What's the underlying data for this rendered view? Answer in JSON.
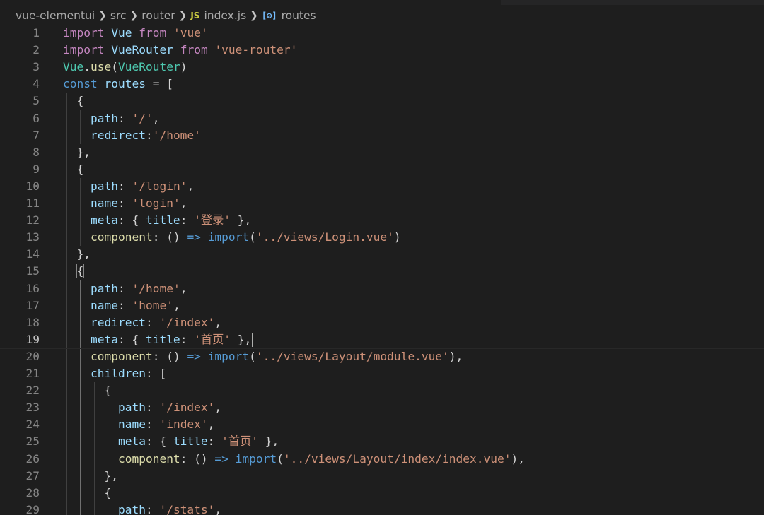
{
  "breadcrumb": {
    "items": [
      "vue-elementui",
      "src",
      "router",
      "index.js",
      "routes"
    ],
    "file_icon": "JS",
    "symbol_icon": "[⊘]"
  },
  "editor": {
    "current_line": 19,
    "lines": [
      {
        "n": "1",
        "t": [
          [
            "kw",
            "import"
          ],
          [
            "pun",
            " "
          ],
          [
            "id",
            "Vue"
          ],
          [
            "pun",
            " "
          ],
          [
            "kw",
            "from"
          ],
          [
            "pun",
            " "
          ],
          [
            "str",
            "'vue'"
          ]
        ]
      },
      {
        "n": "2",
        "t": [
          [
            "kw",
            "import"
          ],
          [
            "pun",
            " "
          ],
          [
            "id",
            "VueRouter"
          ],
          [
            "pun",
            " "
          ],
          [
            "kw",
            "from"
          ],
          [
            "pun",
            " "
          ],
          [
            "str",
            "'vue-router'"
          ]
        ]
      },
      {
        "n": "3",
        "t": [
          [
            "ty",
            "Vue"
          ],
          [
            "pun",
            "."
          ],
          [
            "fn",
            "use"
          ],
          [
            "pun",
            "("
          ],
          [
            "ty",
            "VueRouter"
          ],
          [
            "pun",
            ")"
          ]
        ]
      },
      {
        "n": "4",
        "t": [
          [
            "st",
            "const"
          ],
          [
            "pun",
            " "
          ],
          [
            "id",
            "routes"
          ],
          [
            "pun",
            " = ["
          ]
        ]
      },
      {
        "n": "5",
        "t": [
          [
            "pun",
            "  {"
          ]
        ]
      },
      {
        "n": "6",
        "t": [
          [
            "pun",
            "    "
          ],
          [
            "id",
            "path"
          ],
          [
            "pun",
            ": "
          ],
          [
            "str",
            "'/'"
          ],
          [
            "pun",
            ","
          ]
        ]
      },
      {
        "n": "7",
        "t": [
          [
            "pun",
            "    "
          ],
          [
            "id",
            "redirect"
          ],
          [
            "pun",
            ":"
          ],
          [
            "str",
            "'/home'"
          ]
        ]
      },
      {
        "n": "8",
        "t": [
          [
            "pun",
            "  },"
          ]
        ]
      },
      {
        "n": "9",
        "t": [
          [
            "pun",
            "  {"
          ]
        ]
      },
      {
        "n": "10",
        "t": [
          [
            "pun",
            "    "
          ],
          [
            "id",
            "path"
          ],
          [
            "pun",
            ": "
          ],
          [
            "str",
            "'/login'"
          ],
          [
            "pun",
            ","
          ]
        ]
      },
      {
        "n": "11",
        "t": [
          [
            "pun",
            "    "
          ],
          [
            "id",
            "name"
          ],
          [
            "pun",
            ": "
          ],
          [
            "str",
            "'login'"
          ],
          [
            "pun",
            ","
          ]
        ]
      },
      {
        "n": "12",
        "t": [
          [
            "pun",
            "    "
          ],
          [
            "id",
            "meta"
          ],
          [
            "pun",
            ": { "
          ],
          [
            "id",
            "title"
          ],
          [
            "pun",
            ": "
          ],
          [
            "str",
            "'登录'"
          ],
          [
            "pun",
            " },"
          ]
        ]
      },
      {
        "n": "13",
        "t": [
          [
            "pun",
            "    "
          ],
          [
            "fn",
            "component"
          ],
          [
            "pun",
            ": () "
          ],
          [
            "st",
            "=>"
          ],
          [
            "pun",
            " "
          ],
          [
            "st",
            "import"
          ],
          [
            "pun",
            "("
          ],
          [
            "str",
            "'../views/Login.vue'"
          ],
          [
            "pun",
            ")"
          ]
        ]
      },
      {
        "n": "14",
        "t": [
          [
            "pun",
            "  },"
          ]
        ]
      },
      {
        "n": "15",
        "t": [
          [
            "pun",
            "  "
          ],
          [
            "match",
            "{"
          ]
        ]
      },
      {
        "n": "16",
        "t": [
          [
            "pun",
            "    "
          ],
          [
            "id",
            "path"
          ],
          [
            "pun",
            ": "
          ],
          [
            "str",
            "'/home'"
          ],
          [
            "pun",
            ","
          ]
        ]
      },
      {
        "n": "17",
        "t": [
          [
            "pun",
            "    "
          ],
          [
            "id",
            "name"
          ],
          [
            "pun",
            ": "
          ],
          [
            "str",
            "'home'"
          ],
          [
            "pun",
            ","
          ]
        ]
      },
      {
        "n": "18",
        "t": [
          [
            "pun",
            "    "
          ],
          [
            "id",
            "redirect"
          ],
          [
            "pun",
            ": "
          ],
          [
            "str",
            "'/index'"
          ],
          [
            "pun",
            ","
          ]
        ]
      },
      {
        "n": "19",
        "t": [
          [
            "pun",
            "    "
          ],
          [
            "id",
            "meta"
          ],
          [
            "pun",
            ": { "
          ],
          [
            "id",
            "title"
          ],
          [
            "pun",
            ": "
          ],
          [
            "str",
            "'首页'"
          ],
          [
            "pun",
            " },"
          ],
          [
            "cursor",
            ""
          ]
        ]
      },
      {
        "n": "20",
        "t": [
          [
            "pun",
            "    "
          ],
          [
            "fn",
            "component"
          ],
          [
            "pun",
            ": () "
          ],
          [
            "st",
            "=>"
          ],
          [
            "pun",
            " "
          ],
          [
            "st",
            "import"
          ],
          [
            "pun",
            "("
          ],
          [
            "str",
            "'../views/Layout/module.vue'"
          ],
          [
            "pun",
            "),"
          ]
        ]
      },
      {
        "n": "21",
        "t": [
          [
            "pun",
            "    "
          ],
          [
            "id",
            "children"
          ],
          [
            "pun",
            ": ["
          ]
        ]
      },
      {
        "n": "22",
        "t": [
          [
            "pun",
            "      {"
          ]
        ]
      },
      {
        "n": "23",
        "t": [
          [
            "pun",
            "        "
          ],
          [
            "id",
            "path"
          ],
          [
            "pun",
            ": "
          ],
          [
            "str",
            "'/index'"
          ],
          [
            "pun",
            ","
          ]
        ]
      },
      {
        "n": "24",
        "t": [
          [
            "pun",
            "        "
          ],
          [
            "id",
            "name"
          ],
          [
            "pun",
            ": "
          ],
          [
            "str",
            "'index'"
          ],
          [
            "pun",
            ","
          ]
        ]
      },
      {
        "n": "25",
        "t": [
          [
            "pun",
            "        "
          ],
          [
            "id",
            "meta"
          ],
          [
            "pun",
            ": { "
          ],
          [
            "id",
            "title"
          ],
          [
            "pun",
            ": "
          ],
          [
            "str",
            "'首页'"
          ],
          [
            "pun",
            " },"
          ]
        ]
      },
      {
        "n": "26",
        "t": [
          [
            "pun",
            "        "
          ],
          [
            "fn",
            "component"
          ],
          [
            "pun",
            ": () "
          ],
          [
            "st",
            "=>"
          ],
          [
            "pun",
            " "
          ],
          [
            "st",
            "import"
          ],
          [
            "pun",
            "("
          ],
          [
            "str",
            "'../views/Layout/index/index.vue'"
          ],
          [
            "pun",
            "),"
          ]
        ]
      },
      {
        "n": "27",
        "t": [
          [
            "pun",
            "      },"
          ]
        ]
      },
      {
        "n": "28",
        "t": [
          [
            "pun",
            "      {"
          ]
        ]
      },
      {
        "n": "29",
        "t": [
          [
            "pun",
            "        "
          ],
          [
            "id",
            "path"
          ],
          [
            "pun",
            ": "
          ],
          [
            "str",
            "'/stats'"
          ],
          [
            "pun",
            ","
          ]
        ]
      }
    ]
  }
}
